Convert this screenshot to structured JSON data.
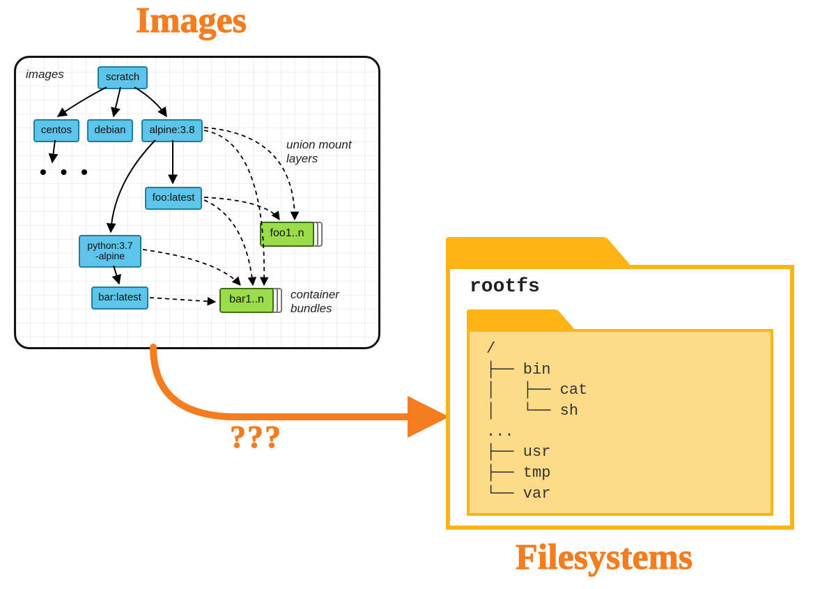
{
  "titles": {
    "images": "Images",
    "filesystems": "Filesystems",
    "question": "???"
  },
  "panel": {
    "images_label": "images",
    "union_label": "union mount\nlayers",
    "bundles_label": "container\nbundles",
    "ellipsis": "• • •",
    "nodes": {
      "scratch": "scratch",
      "centos": "centos",
      "debian": "debian",
      "alpine": "alpine:3.8",
      "foo": "foo:latest",
      "python": "python:3.7\n-alpine",
      "bar": "bar:latest",
      "foo_bundle": "foo1..n",
      "bar_bundle": "bar1..n"
    }
  },
  "folder": {
    "rootfs": "rootfs",
    "tree_lines": [
      "/",
      "├── bin",
      "│   ├── cat",
      "│   └── sh",
      "...",
      "├── usr",
      "├── tmp",
      "└── var"
    ]
  }
}
